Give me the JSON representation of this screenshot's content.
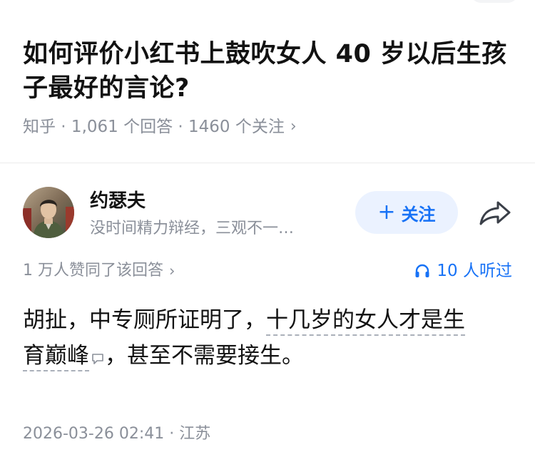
{
  "question": {
    "title": "如何评价小红书上鼓吹女人 40 岁以后生孩子最好的言论?",
    "meta": "知乎 · 1,061 个回答 · 1460 个关注",
    "chevron": "›"
  },
  "author": {
    "name": "约瑟夫",
    "bio": "没时间精力辩经，三观不一…",
    "follow_label": "关注",
    "follow_plus": "+"
  },
  "stats": {
    "upvote_text": "1 万人赞同了该回答",
    "chevron": "›",
    "listen_text": "10 人听过"
  },
  "answer": {
    "part1": "胡扯，中专厕所证明了，",
    "linked_part1": "十几岁的女人才是生",
    "linked_part2": "育巅峰",
    "part2": "，甚至不需要接生。"
  },
  "footer": {
    "datetime_location": "2026-03-26 02:41 · 江苏"
  },
  "colors": {
    "accent": "#1772f6",
    "follow_bg": "#ebf2ff",
    "meta_gray": "#8a8f99",
    "text": "#121212"
  },
  "icons": {
    "share": "share-icon",
    "headphones": "headphones-icon",
    "comment": "comment-icon",
    "chevron": "chevron-right-icon"
  }
}
